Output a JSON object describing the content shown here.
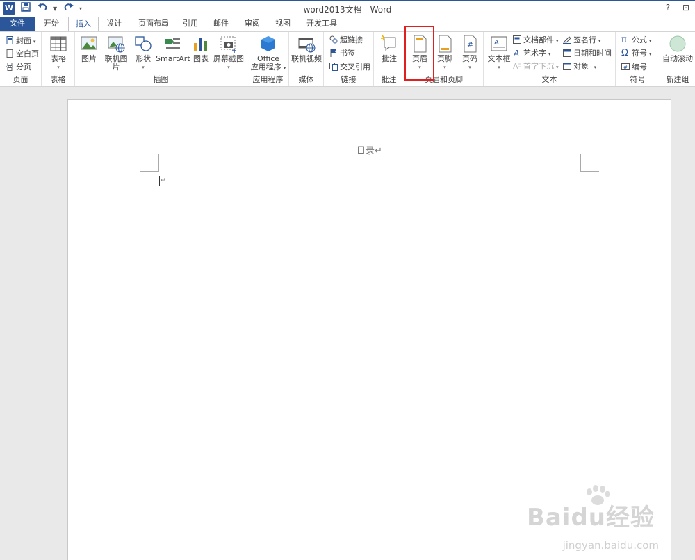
{
  "window": {
    "title": "word2013文档 - Word",
    "help": "?",
    "restore": "⊡"
  },
  "qat": {
    "logo": "W",
    "save_icon": "save-icon",
    "undo_icon": "undo-icon",
    "redo_icon": "redo-icon"
  },
  "tabs": [
    "文件",
    "开始",
    "插入",
    "设计",
    "页面布局",
    "引用",
    "邮件",
    "审阅",
    "视图",
    "开发工具"
  ],
  "active_tab": "插入",
  "ribbon": {
    "pages": {
      "label": "页面",
      "cover": "封面",
      "blank": "空白页",
      "break": "分页"
    },
    "tables": {
      "label": "表格",
      "table": "表格"
    },
    "illustrations": {
      "label": "插图",
      "picture": "图片",
      "online_picture": "联机图片",
      "shapes": "形状",
      "smartart": "SmartArt",
      "chart": "图表",
      "screenshot": "屏幕截图"
    },
    "apps": {
      "label": "应用程序",
      "office_line1": "Office",
      "office_line2": "应用程序"
    },
    "media": {
      "label": "媒体",
      "online_video": "联机视频"
    },
    "links": {
      "label": "链接",
      "hyperlink": "超链接",
      "bookmark": "书签",
      "cross_ref": "交叉引用"
    },
    "comments": {
      "label": "批注",
      "comment": "批注"
    },
    "header_footer": {
      "label": "页眉和页脚",
      "header": "页眉",
      "footer": "页脚",
      "page_number": "页码"
    },
    "text": {
      "label": "文本",
      "textbox": "文本框",
      "quick_parts": "文档部件",
      "wordart": "艺术字",
      "dropcap": "首字下沉",
      "signature": "签名行",
      "datetime": "日期和时间",
      "object": "对象"
    },
    "symbols": {
      "label": "符号",
      "equation": "公式",
      "symbol": "符号",
      "number": "编号"
    },
    "new_group": {
      "label": "新建组",
      "auto_scroll": "自动滚动"
    }
  },
  "document": {
    "header_text": "目录↵",
    "paragraph_mark": "↵"
  },
  "watermark": {
    "brand": "Baidu经验",
    "url": "jingyan.baidu.com"
  },
  "colors": {
    "accent": "#2b579a",
    "highlight": "#e02020"
  }
}
